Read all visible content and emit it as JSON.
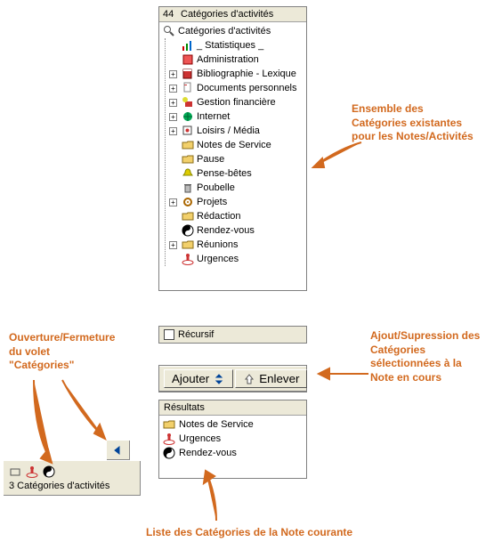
{
  "header": {
    "count": "44",
    "title": "Catégories d'activités"
  },
  "tree": {
    "root_label": "Catégories d'activités",
    "items": [
      {
        "exp": "",
        "icon": "chart-icon",
        "label": "_ Statistiques _"
      },
      {
        "exp": "",
        "icon": "admin-icon",
        "label": "Administration"
      },
      {
        "exp": "+",
        "icon": "book-icon",
        "label": "Bibliographie - Lexique"
      },
      {
        "exp": "+",
        "icon": "doc-icon",
        "label": "Documents personnels"
      },
      {
        "exp": "+",
        "icon": "money-icon",
        "label": "Gestion financière"
      },
      {
        "exp": "+",
        "icon": "globe-icon",
        "label": "Internet"
      },
      {
        "exp": "+",
        "icon": "media-icon",
        "label": "Loisirs / Média"
      },
      {
        "exp": "",
        "icon": "folder-icon",
        "label": "Notes de Service"
      },
      {
        "exp": "",
        "icon": "folder-icon",
        "label": "Pause"
      },
      {
        "exp": "",
        "icon": "bell-icon",
        "label": "Pense-bêtes"
      },
      {
        "exp": "",
        "icon": "trash-icon",
        "label": "Poubelle"
      },
      {
        "exp": "+",
        "icon": "gear-icon",
        "label": "Projets"
      },
      {
        "exp": "",
        "icon": "folder-icon",
        "label": "Rédaction"
      },
      {
        "exp": "",
        "icon": "yinyang-icon",
        "label": "Rendez-vous"
      },
      {
        "exp": "+",
        "icon": "folder-icon",
        "label": "Réunions"
      },
      {
        "exp": "",
        "icon": "urgent-icon",
        "label": "Urgences"
      }
    ]
  },
  "recursive_label": "Récursif",
  "buttons": {
    "add": "Ajouter",
    "remove": "Enlever"
  },
  "results": {
    "title": "Résultats",
    "items": [
      {
        "icon": "folder-icon",
        "label": "Notes de Service"
      },
      {
        "icon": "urgent-icon",
        "label": "Urgences"
      },
      {
        "icon": "yinyang-icon",
        "label": "Rendez-vous"
      }
    ]
  },
  "mini": {
    "count_label": "3 Catégories d'activités"
  },
  "callouts": {
    "ensemble": "Ensemble des\nCatégories existantes\npour les Notes/Activités",
    "add_remove": "Ajout/Supression des\nCatégories\nsélectionnées à la\nNote en cours",
    "open_close": "Ouverture/Fermeture\ndu volet\n\"Catégories\"",
    "list": "Liste des Catégories de la Note courante"
  },
  "colors": {
    "callout": "#d2691e"
  }
}
